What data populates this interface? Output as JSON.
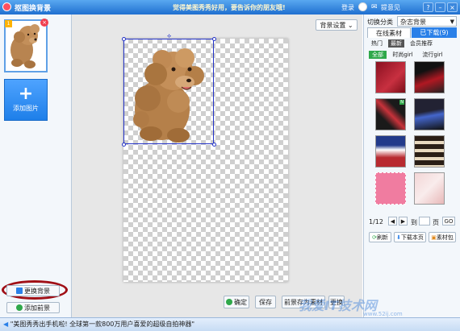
{
  "window": {
    "title": "抠图换背景",
    "slogan": "觉得美图秀秀好用，要告诉你的朋友哦!",
    "login": "登录",
    "feedback": "提意见",
    "controls": [
      "?",
      "–",
      "×"
    ]
  },
  "left_panel": {
    "thumb_index": "1",
    "add_picture": "添加图片",
    "change_background": "更换背景",
    "add_background": "添加前景"
  },
  "canvas": {
    "background_settings": "背景设置",
    "buttons": {
      "confirm": "确定",
      "save": "保存",
      "save_as_material": "前景存为素材",
      "replace_prefix": "更换"
    }
  },
  "right_panel": {
    "category_label": "切换分类",
    "category_value": "杂志背景",
    "tabs": {
      "online": "在线素材",
      "downloaded": "已下载(9)"
    },
    "subtabs": [
      "热门",
      "最新",
      "会员推荐"
    ],
    "filters": [
      "全部",
      "时尚girl",
      "流行girl"
    ],
    "pagination": {
      "page": "1/12",
      "goto": "到",
      "unit": "页",
      "go": "GO"
    },
    "actions": {
      "refresh": "刷新",
      "download_page": "下载本页",
      "material_pack": "素材包"
    }
  },
  "status": {
    "text": "\"美图秀秀出手机啦! 全球第一款800万用户喜爱的超级自拍神器\""
  },
  "watermark": {
    "text": "我爱IT技术网",
    "url": "www.52ij.com"
  },
  "colors": {
    "titlebar": "#1f6fd0",
    "accent_blue": "#2a80e8",
    "selection": "#2433c8",
    "annotation_red": "#a00f16"
  }
}
